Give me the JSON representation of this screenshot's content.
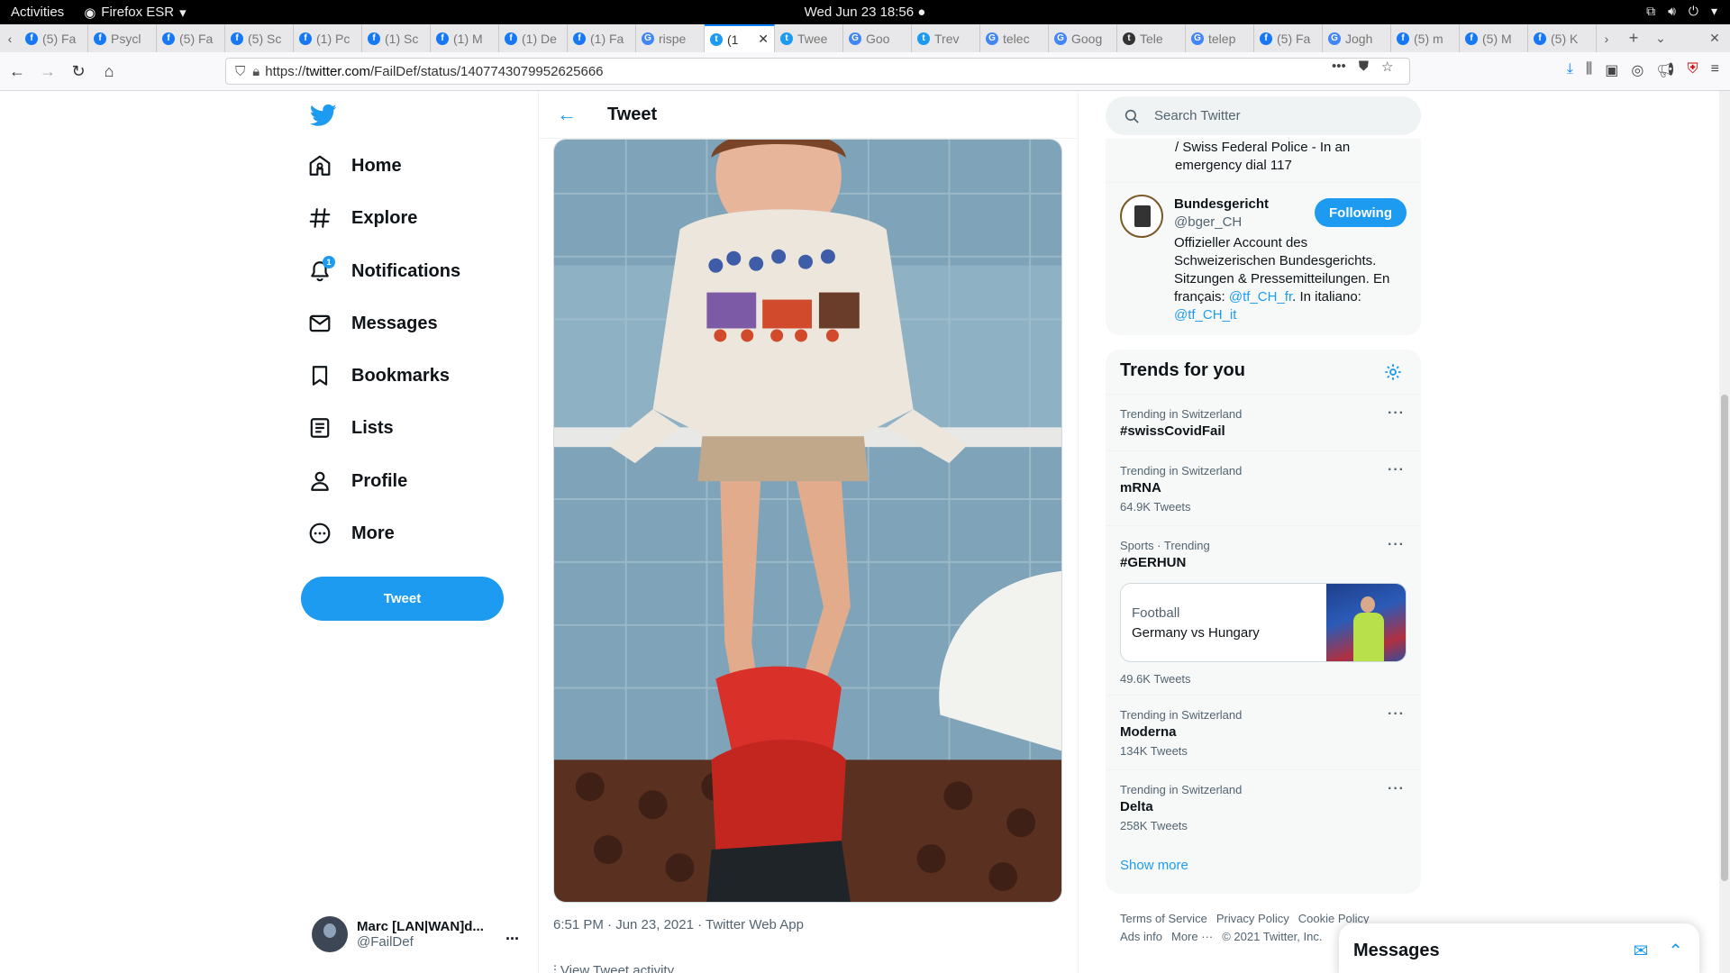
{
  "gnome": {
    "activities": "Activities",
    "app": "Firefox ESR",
    "clock": "Wed Jun 23  18:56"
  },
  "tabs": [
    {
      "title": "(5) Fa",
      "fav": "f",
      "color": "#1877f2"
    },
    {
      "title": "Psycl",
      "fav": "f",
      "color": "#1877f2"
    },
    {
      "title": "(5) Fa",
      "fav": "f",
      "color": "#1877f2"
    },
    {
      "title": "(5) Sc",
      "fav": "f",
      "color": "#1877f2"
    },
    {
      "title": "(1) Pc",
      "fav": "f",
      "color": "#1877f2"
    },
    {
      "title": "(1) Sc",
      "fav": "f",
      "color": "#1877f2"
    },
    {
      "title": "(1) M",
      "fav": "f",
      "color": "#1877f2"
    },
    {
      "title": "(1) De",
      "fav": "f",
      "color": "#1877f2"
    },
    {
      "title": "(1) Fa",
      "fav": "f",
      "color": "#1877f2"
    },
    {
      "title": "rispe",
      "fav": "G",
      "color": "#4285f4"
    },
    {
      "title": "(1",
      "fav": "t",
      "color": "#1d9bf0",
      "active": true
    },
    {
      "title": "Twee",
      "fav": "t",
      "color": "#1d9bf0"
    },
    {
      "title": "Goo",
      "fav": "G",
      "color": "#4285f4"
    },
    {
      "title": "Trev",
      "fav": "t",
      "color": "#1d9bf0"
    },
    {
      "title": "telec",
      "fav": "G",
      "color": "#4285f4"
    },
    {
      "title": "Goog",
      "fav": "G",
      "color": "#4285f4"
    },
    {
      "title": "Tele",
      "fav": "t",
      "color": "#333"
    },
    {
      "title": "telep",
      "fav": "G",
      "color": "#4285f4"
    },
    {
      "title": "(5) Fa",
      "fav": "f",
      "color": "#1877f2"
    },
    {
      "title": "Jogh",
      "fav": "G",
      "color": "#4285f4"
    },
    {
      "title": "(5) m",
      "fav": "f",
      "color": "#1877f2"
    },
    {
      "title": "(5) M",
      "fav": "f",
      "color": "#1877f2"
    },
    {
      "title": "(5) K",
      "fav": "f",
      "color": "#1877f2"
    }
  ],
  "address": {
    "prefix": "https://",
    "host": "twitter.com",
    "path": "/FailDef/status/1407743079952625666"
  },
  "nav": {
    "home": "Home",
    "explore": "Explore",
    "notifications": "Notifications",
    "notifications_badge": "1",
    "messages": "Messages",
    "bookmarks": "Bookmarks",
    "lists": "Lists",
    "profile": "Profile",
    "more": "More",
    "tweet_button": "Tweet"
  },
  "account": {
    "name": "Marc [LAN|WAN]d...",
    "handle": "@FailDef",
    "more": "..."
  },
  "tweet": {
    "header": "Tweet",
    "meta": "6:51 PM · Jun 23, 2021 · Twitter Web App",
    "activity": "View Tweet activity"
  },
  "search": {
    "placeholder": "Search Twitter"
  },
  "follow": {
    "prev_bio": "/ Swiss Federal Police - In an emergency dial 117",
    "name": "Bundesgericht",
    "handle": "@bger_CH",
    "button": "Following",
    "bio_a": "Offizieller Account des Schweizerischen Bundesgerichts. Sitzungen & Pressemitteilungen. En français: ",
    "mention1": "@tf_CH_fr",
    "bio_b": ". In italiano: ",
    "mention2": "@tf_CH_it"
  },
  "trends": {
    "title": "Trends for you",
    "items": [
      {
        "context": "Trending in Switzerland",
        "name": "#swissCovidFail",
        "count": ""
      },
      {
        "context": "Trending in Switzerland",
        "name": "mRNA",
        "count": "64.9K Tweets"
      },
      {
        "context": "Sports · Trending",
        "name": "#GERHUN",
        "count": "49.6K Tweets"
      },
      {
        "context": "Trending in Switzerland",
        "name": "Moderna",
        "count": "134K Tweets"
      },
      {
        "context": "Trending in Switzerland",
        "name": "Delta",
        "count": "258K Tweets"
      }
    ],
    "event_category": "Football",
    "event_title": "Germany vs Hungary",
    "show_more": "Show more"
  },
  "footer": {
    "terms": "Terms of Service",
    "privacy": "Privacy Policy",
    "cookie": "Cookie Policy",
    "ads": "Ads info",
    "more": "More ···",
    "copyright": "© 2021 Twitter, Inc."
  },
  "messages_drawer": {
    "title": "Messages"
  }
}
